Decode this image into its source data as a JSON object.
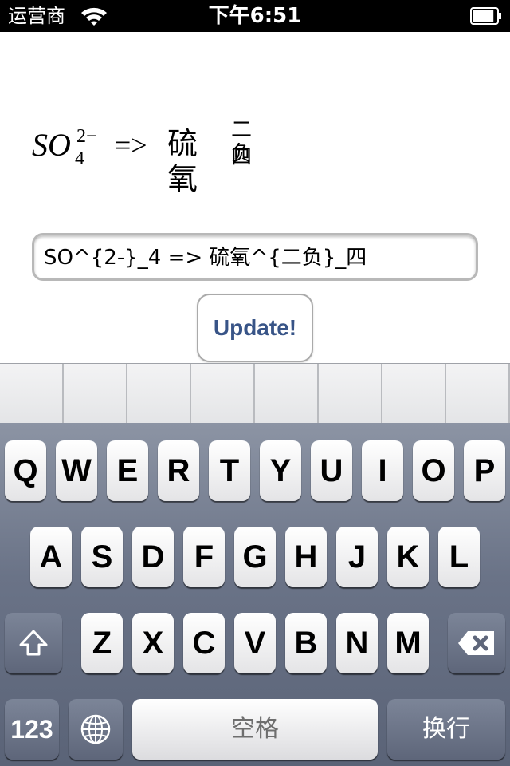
{
  "status_bar": {
    "carrier": "运营商",
    "time": "下午6:51",
    "wifi_icon": "wifi-icon",
    "battery_icon": "battery-icon",
    "battery_level": 0.9
  },
  "formula": {
    "base": "SO",
    "superscript": "2−",
    "subscript": "4",
    "arrow": "=>",
    "cjk_base": "硫氧",
    "cjk_superscript": "二负",
    "cjk_subscript": "四"
  },
  "input": {
    "value": "SO^{2-}_4 => 硫氧^{二负}_四"
  },
  "update_button": {
    "label": "Update!"
  },
  "candidate_bar": {
    "cell_count": 8
  },
  "keyboard": {
    "row1": [
      "Q",
      "W",
      "E",
      "R",
      "T",
      "Y",
      "U",
      "I",
      "O",
      "P"
    ],
    "row2": [
      "A",
      "S",
      "D",
      "F",
      "G",
      "H",
      "J",
      "K",
      "L"
    ],
    "row3": [
      "Z",
      "X",
      "C",
      "V",
      "B",
      "N",
      "M"
    ],
    "shift_icon": "shift-icon",
    "delete_icon": "delete-icon",
    "numbers_label": "123",
    "globe_icon": "globe-icon",
    "space_label": "空格",
    "return_label": "换行"
  }
}
